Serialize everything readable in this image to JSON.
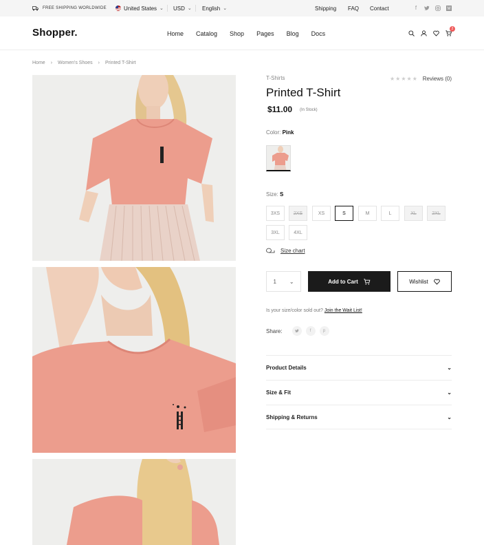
{
  "topbar": {
    "shipping_text": "FREE SHIPPING WORLDWIDE",
    "country": "United States",
    "currency": "USD",
    "language": "English",
    "links": [
      "Shipping",
      "FAQ",
      "Contact"
    ],
    "social_icons": [
      "facebook-icon",
      "twitter-icon",
      "instagram-icon",
      "medium-icon"
    ]
  },
  "header": {
    "logo": "Shopper.",
    "nav": [
      "Home",
      "Catalog",
      "Shop",
      "Pages",
      "Blog",
      "Docs"
    ],
    "icons": [
      "search-icon",
      "user-icon",
      "heart-icon",
      "cart-icon"
    ],
    "cart_count": "2"
  },
  "breadcrumb": [
    "Home",
    "Women's Shoes",
    "Printed T-Shirt"
  ],
  "product": {
    "category": "T-Shirts",
    "rating": 0,
    "reviews": "Reviews (0)",
    "title": "Printed T-Shirt",
    "price": "$11.00",
    "stock": "(In Stock)",
    "color_label": "Color:",
    "color_value": "Pink",
    "size_label": "Size:",
    "size_value": "S",
    "sizes": [
      {
        "label": "3XS",
        "state": "available"
      },
      {
        "label": "2XS",
        "state": "unavailable"
      },
      {
        "label": "XS",
        "state": "available"
      },
      {
        "label": "S",
        "state": "selected"
      },
      {
        "label": "M",
        "state": "available"
      },
      {
        "label": "L",
        "state": "available"
      },
      {
        "label": "XL",
        "state": "unavailable"
      },
      {
        "label": "2XL",
        "state": "unavailable"
      },
      {
        "label": "3XL",
        "state": "available"
      },
      {
        "label": "4XL",
        "state": "available"
      }
    ],
    "size_chart": "Size chart",
    "quantity": "1",
    "add_to_cart": "Add to Cart",
    "wishlist": "Wishlist",
    "wait_text": "Is your size/color sold out?",
    "wait_link": "Join the Wait List!",
    "share_label": "Share:",
    "accordions": [
      "Product Details",
      "Size & Fit",
      "Shipping & Returns"
    ]
  },
  "colors": {
    "accent": "#1b1b1b",
    "badge": "#ef5b5b",
    "shirt": "#e8998d"
  }
}
